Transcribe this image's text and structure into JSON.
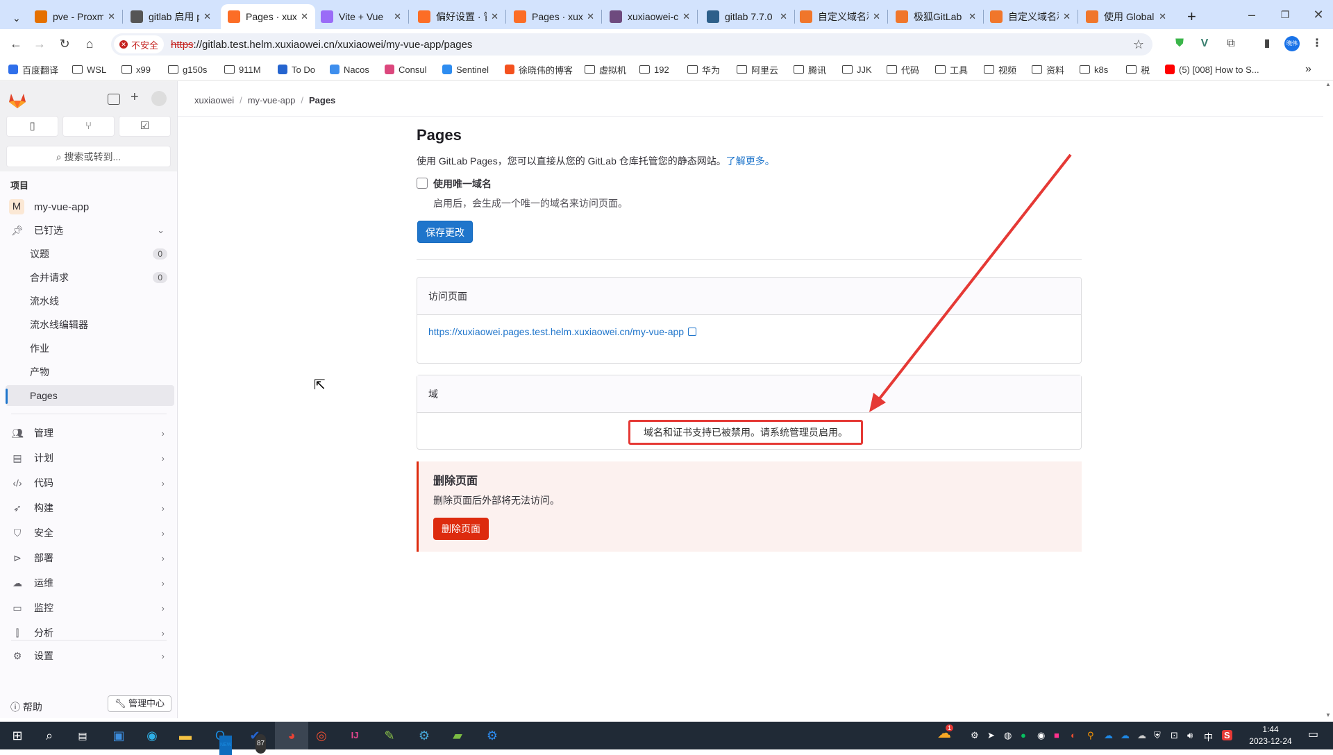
{
  "browser": {
    "tabs": [
      {
        "title": "pve - Proxmox",
        "icon": "proxmox-icon",
        "color": "#e57000"
      },
      {
        "title": "gitlab 启用 pages",
        "icon": "bookmark-favicon",
        "color": "#555555"
      },
      {
        "title": "Pages · xuxiaowei",
        "icon": "gitlab-icon",
        "color": "#fc6d26",
        "active": true
      },
      {
        "title": "Vite + Vue",
        "icon": "vite-icon",
        "color": "#9a6cf7"
      },
      {
        "title": "偏好设置 · 管理",
        "icon": "gitlab-icon",
        "color": "#fc6d26"
      },
      {
        "title": "Pages · xuxiaowei",
        "icon": "gitlab-icon",
        "color": "#fc6d26"
      },
      {
        "title": "xuxiaowei-com",
        "icon": "git-icon",
        "color": "#6e4a7e"
      },
      {
        "title": "gitlab 7.7.0",
        "icon": "hexagon-icon",
        "color": "#2d5f8a"
      },
      {
        "title": "自定义域名和",
        "icon": "gitbook-icon",
        "color": "#f0762b"
      },
      {
        "title": "极狐GitLab",
        "icon": "gitbook-icon",
        "color": "#f0762b"
      },
      {
        "title": "自定义域名和",
        "icon": "gitbook-icon",
        "color": "#f0762b"
      },
      {
        "title": "使用 Global",
        "icon": "gitbook-icon",
        "color": "#f0762b"
      }
    ],
    "new_tab": "+",
    "security_label": "不安全",
    "url_scheme": "https",
    "url_rest": "://gitlab.test.helm.xuxiaowei.cn/xuxiaowei/my-vue-app/pages",
    "profile_label": "晓伟",
    "bookmarks": [
      {
        "label": "百度翻译",
        "type": "app",
        "color": "#2f6fea"
      },
      {
        "label": "WSL",
        "type": "folder"
      },
      {
        "label": "x99",
        "type": "folder"
      },
      {
        "label": "g150s",
        "type": "folder"
      },
      {
        "label": "911M",
        "type": "folder"
      },
      {
        "label": "To Do",
        "type": "app",
        "color": "#2564cf"
      },
      {
        "label": "Nacos",
        "type": "app",
        "color": "#3e8eed"
      },
      {
        "label": "Consul",
        "type": "app",
        "color": "#dc477d"
      },
      {
        "label": "Sentinel",
        "type": "app",
        "color": "#2d8cf0"
      },
      {
        "label": "徐晓伟的博客",
        "type": "app",
        "color": "#f4511e"
      },
      {
        "label": "虚拟机",
        "type": "folder"
      },
      {
        "label": "192",
        "type": "folder"
      },
      {
        "label": "华为",
        "type": "folder"
      },
      {
        "label": "阿里云",
        "type": "folder"
      },
      {
        "label": "腾讯",
        "type": "folder"
      },
      {
        "label": "JJK",
        "type": "folder"
      },
      {
        "label": "代码",
        "type": "folder"
      },
      {
        "label": "工具",
        "type": "folder"
      },
      {
        "label": "视频",
        "type": "folder"
      },
      {
        "label": "资料",
        "type": "folder"
      },
      {
        "label": "k8s",
        "type": "folder"
      },
      {
        "label": "税",
        "type": "folder"
      },
      {
        "label": "(5) [008] How to S...",
        "type": "app",
        "color": "#ff0000"
      }
    ]
  },
  "sidebar": {
    "search_label": "搜索或转到...",
    "section_label": "项目",
    "project": {
      "avatar": "M",
      "name": "my-vue-app"
    },
    "pinned_label": "已钉选",
    "pinned_items": [
      {
        "label": "议题",
        "count": "0"
      },
      {
        "label": "合并请求",
        "count": "0"
      },
      {
        "label": "流水线"
      },
      {
        "label": "流水线编辑器"
      },
      {
        "label": "作业"
      },
      {
        "label": "产物"
      },
      {
        "label": "Pages",
        "active": true
      }
    ],
    "groups": [
      {
        "label": "管理",
        "icon": "users-icon"
      },
      {
        "label": "计划",
        "icon": "calendar-icon"
      },
      {
        "label": "代码",
        "icon": "code-icon"
      },
      {
        "label": "构建",
        "icon": "rocket-icon"
      },
      {
        "label": "安全",
        "icon": "shield-icon"
      },
      {
        "label": "部署",
        "icon": "deploy-icon"
      },
      {
        "label": "运维",
        "icon": "cloud-gear-icon"
      },
      {
        "label": "监控",
        "icon": "monitor-icon"
      },
      {
        "label": "分析",
        "icon": "chart-icon"
      }
    ],
    "settings_label": "设置",
    "help_label": "帮助",
    "admin_label": "管理中心"
  },
  "breadcrumb": [
    "xuxiaowei",
    "my-vue-app",
    "Pages"
  ],
  "main": {
    "title": "Pages",
    "description": "使用 GitLab Pages，您可以直接从您的 GitLab 仓库托管您的静态网站。",
    "learn_more": "了解更多。",
    "unique_domain_label": "使用唯一域名",
    "unique_domain_checked": false,
    "unique_domain_help": "启用后，会生成一个唯一的域名来访问页面。",
    "save_button": "保存更改",
    "access_card_title": "访问页面",
    "access_url": "https://xuxiaowei.pages.test.helm.xuxiaowei.cn/my-vue-app",
    "domains_card_title": "域",
    "domains_notice": "域名和证书支持已被禁用。请系统管理员启用。",
    "danger_title": "删除页面",
    "danger_desc": "删除页面后外部将无法访问。",
    "delete_button": "删除页面"
  },
  "taskbar": {
    "outlook_badge": "NEW",
    "todo_badge": "87",
    "weather_badge": "1",
    "ime": "中",
    "time": "1:44",
    "date": "2023-12-24"
  },
  "annotation_color": "#e53935"
}
